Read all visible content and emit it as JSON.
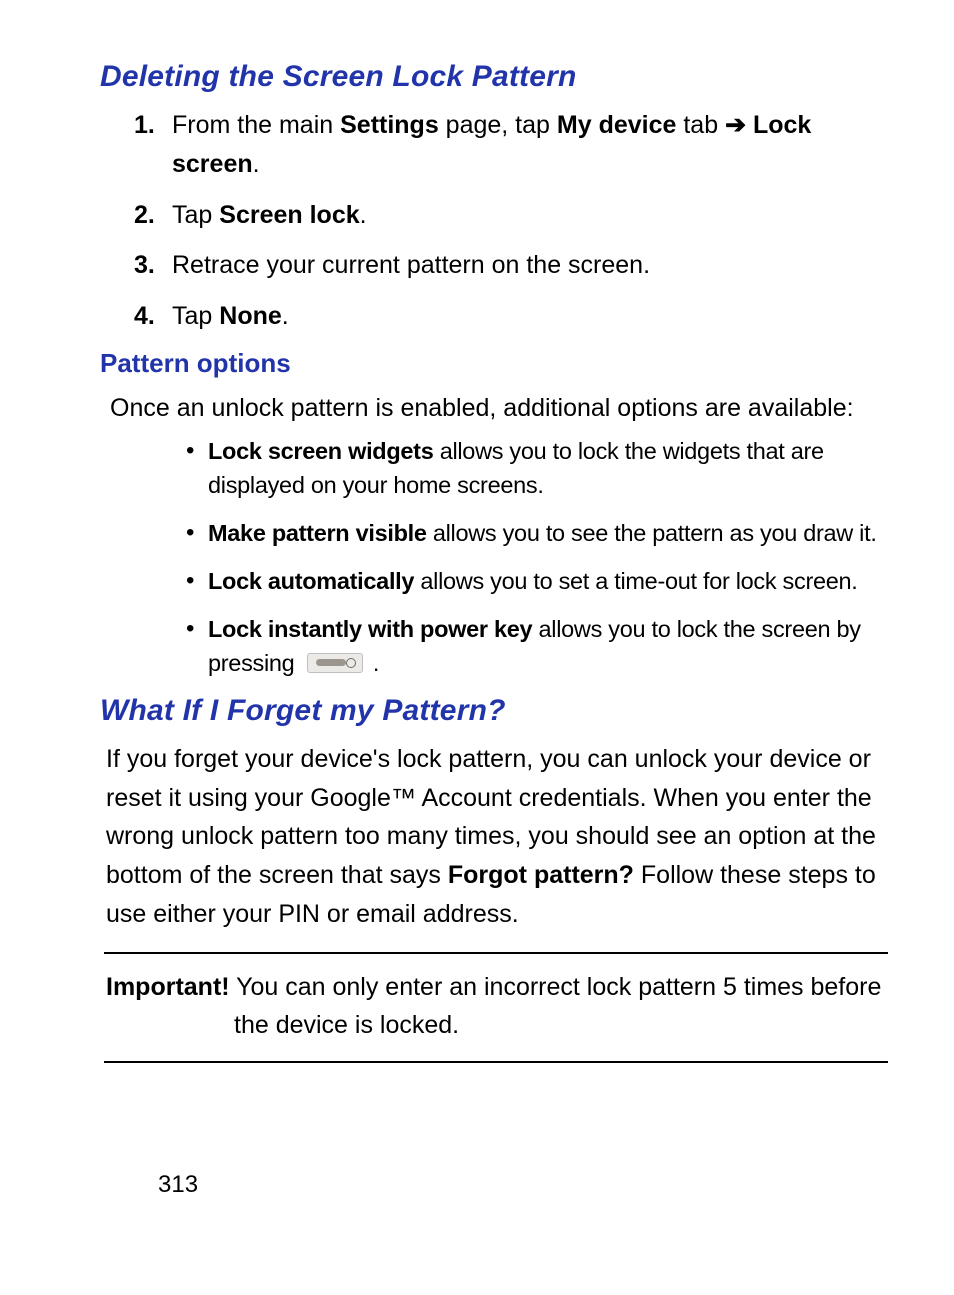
{
  "section1": {
    "title": "Deleting the Screen Lock Pattern",
    "steps": {
      "s1": {
        "pre": "From the main ",
        "b1": "Settings",
        "mid1": " page, tap ",
        "b2": "My device",
        "mid2": " tab ",
        "arrow": "➔",
        "b3": " Lock screen",
        "post": "."
      },
      "s2": {
        "pre": "Tap ",
        "b1": "Screen lock",
        "post": "."
      },
      "s3": {
        "text": "Retrace your current pattern on the screen."
      },
      "s4": {
        "pre": "Tap ",
        "b1": "None",
        "post": "."
      }
    }
  },
  "patternOptions": {
    "heading": "Pattern options",
    "intro": "Once an unlock pattern is enabled, additional options are available:",
    "items": {
      "i1": {
        "b": "Lock screen widgets",
        "rest": " allows you to lock the widgets that are displayed on your home screens."
      },
      "i2": {
        "b": "Make pattern visible",
        "rest": " allows you to see the pattern as you draw it."
      },
      "i3": {
        "b": "Lock automatically",
        "rest": " allows you to set a time-out for lock screen."
      },
      "i4": {
        "b": "Lock instantly with power key",
        "restPre": " allows you to lock the screen by pressing ",
        "restPost": " ."
      }
    }
  },
  "section2": {
    "title": "What If I Forget my Pattern?",
    "para": {
      "p1": "If you forget your device's lock pattern, you can unlock your device or reset it using your Google™ Account credentials. When you enter the wrong unlock pattern too many times, you should see an option at the bottom of the screen that says ",
      "b1": "Forgot pattern?",
      "p2": " Follow these steps to use either your PIN or email address."
    }
  },
  "important": {
    "label": "Important!",
    "line1_rest": " You can only enter an incorrect lock pattern 5 times before",
    "line2": "the device is locked."
  },
  "pageNumber": "313"
}
